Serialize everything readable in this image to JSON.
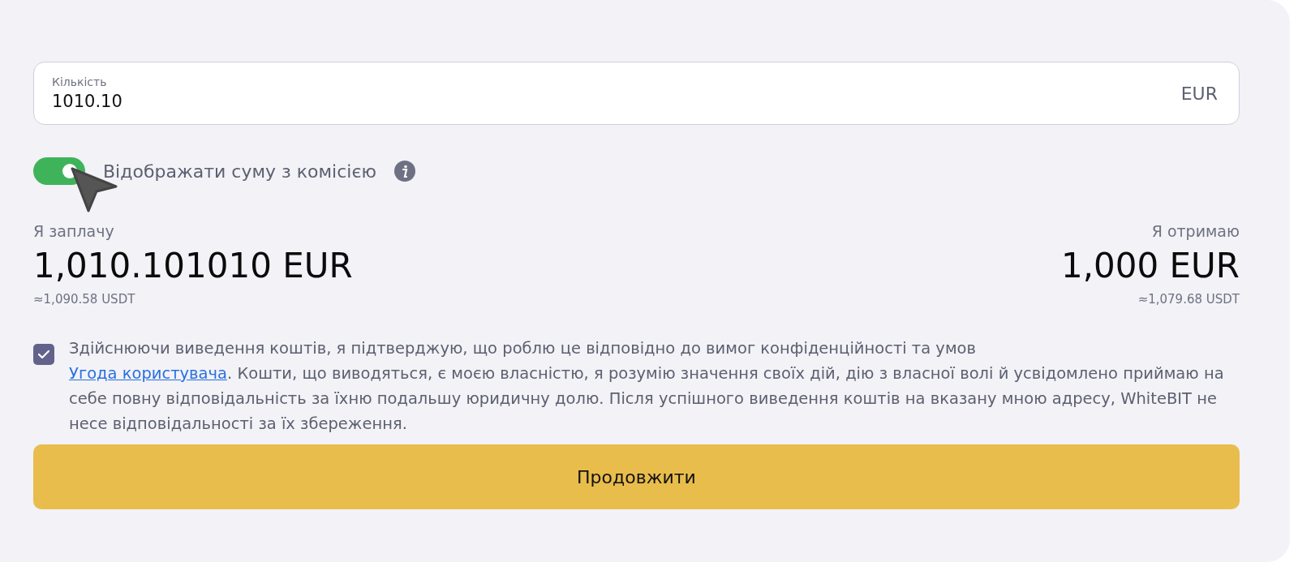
{
  "amount_field": {
    "label": "Кількість",
    "value": "1010.10",
    "currency": "EUR"
  },
  "fee_toggle": {
    "on": true,
    "label": "Відображати суму з комісією"
  },
  "pay": {
    "label": "Я заплачу",
    "amount": "1,010.101010 EUR",
    "approx": "≈1,090.58 USDT"
  },
  "receive": {
    "label": "Я отримаю",
    "amount": "1,000 EUR",
    "approx": "≈1,079.68 USDT"
  },
  "agreement": {
    "checked": true,
    "text_before": "Здійснюючи виведення коштів, я підтверджую, що роблю це відповідно до вимог конфіденційності та умов",
    "link": "Угода користувача",
    "text_after": ". Кошти, що виводяться, є моєю власністю, я розумію значення своїх дій, дію з власної волі й усвідомлено приймаю на себе повну відповідальність за їхню подальшу юридичну долю. Після успішного виведення коштів на вказану мною адресу, WhiteBIT не несе відповідальності за їх збереження."
  },
  "continue_button": "Продовжити"
}
